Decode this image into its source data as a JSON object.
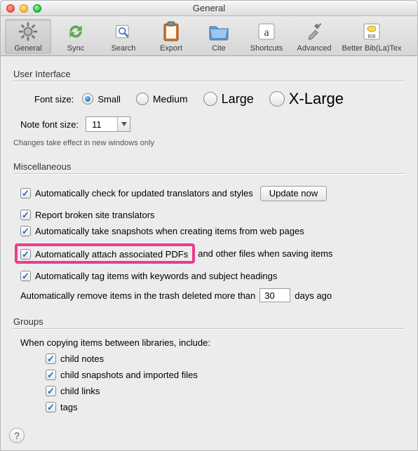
{
  "window": {
    "title": "General"
  },
  "toolbar": {
    "items": [
      {
        "name": "general",
        "label": "General",
        "icon": "gear-icon",
        "active": true
      },
      {
        "name": "sync",
        "label": "Sync",
        "icon": "sync-icon",
        "active": false
      },
      {
        "name": "search",
        "label": "Search",
        "icon": "search-icon",
        "active": false
      },
      {
        "name": "export",
        "label": "Export",
        "icon": "clipboard-icon",
        "active": false
      },
      {
        "name": "cite",
        "label": "Cite",
        "icon": "folder-icon",
        "active": false
      },
      {
        "name": "shortcuts",
        "label": "Shortcuts",
        "icon": "letter-a-icon",
        "active": false
      },
      {
        "name": "advanced",
        "label": "Advanced",
        "icon": "tools-icon",
        "active": false
      },
      {
        "name": "betterbib",
        "label": "Better Bib(La)Tex",
        "icon": "bib-icon",
        "active": false
      }
    ]
  },
  "ui_section": {
    "title": "User Interface",
    "font_size_label": "Font size:",
    "font_size_options": [
      "Small",
      "Medium",
      "Large",
      "X-Large"
    ],
    "font_size_selected": "Small",
    "note_font_label": "Note font size:",
    "note_font_value": "11",
    "change_note": "Changes take effect in new windows only"
  },
  "misc_section": {
    "title": "Miscellaneous",
    "items": {
      "auto_update": "Automatically check for updated translators and styles",
      "update_btn": "Update now",
      "report_broken": "Report broken site translators",
      "snapshots": "Automatically take snapshots when creating items from web pages",
      "attach_pdfs_a": "Automatically attach associated PDFs",
      "attach_pdfs_b": "and other files when saving items",
      "auto_tag": "Automatically tag items with keywords and subject headings",
      "trash_a": "Automatically remove items in the trash deleted more than",
      "trash_value": "30",
      "trash_b": "days ago"
    }
  },
  "groups_section": {
    "title": "Groups",
    "lead": "When copying items between libraries, include:",
    "items": {
      "child_notes": "child notes",
      "child_snapshots": "child snapshots and imported files",
      "child_links": "child links",
      "tags": "tags"
    }
  },
  "help": "?"
}
